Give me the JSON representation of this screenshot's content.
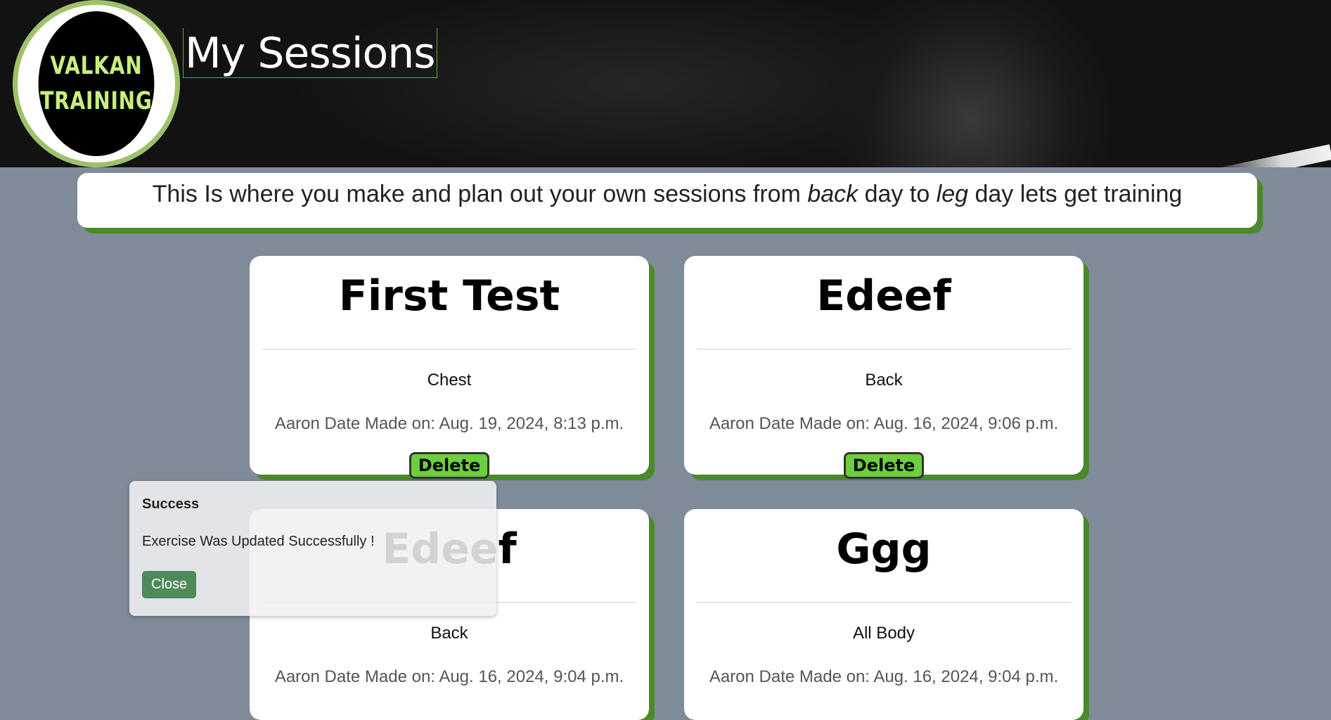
{
  "header": {
    "logo_lines": [
      "VALKAN",
      "TRAINING"
    ],
    "title": "My Sessions"
  },
  "intro": {
    "before": "This Is where you make and plan out your own sessions from ",
    "em1": "back",
    "middle": " day to ",
    "em2": "leg",
    "after": " day lets get training"
  },
  "sessions": [
    {
      "name": "First Test",
      "category": "Chest",
      "meta": "Aaron Date Made on: Aug. 19, 2024, 8:13 p.m.",
      "delete_label": "Delete"
    },
    {
      "name": "Edeef",
      "category": "Back",
      "meta": "Aaron Date Made on: Aug. 16, 2024, 9:06 p.m.",
      "delete_label": "Delete"
    },
    {
      "name": "Edeef",
      "category": "Back",
      "meta": "Aaron Date Made on: Aug. 16, 2024, 9:04 p.m."
    },
    {
      "name": "Ggg",
      "category": "All Body",
      "meta": "Aaron Date Made on: Aug. 16, 2024, 9:04 p.m."
    }
  ],
  "toast": {
    "title": "Success",
    "message": "Exercise Was Updated Successfully !",
    "close_label": "Close"
  },
  "colors": {
    "accent_green": "#6ccf3d",
    "shadow_green": "#4a8a2a",
    "logo_text": "#c8ef7c",
    "background": "#7f8b99"
  }
}
